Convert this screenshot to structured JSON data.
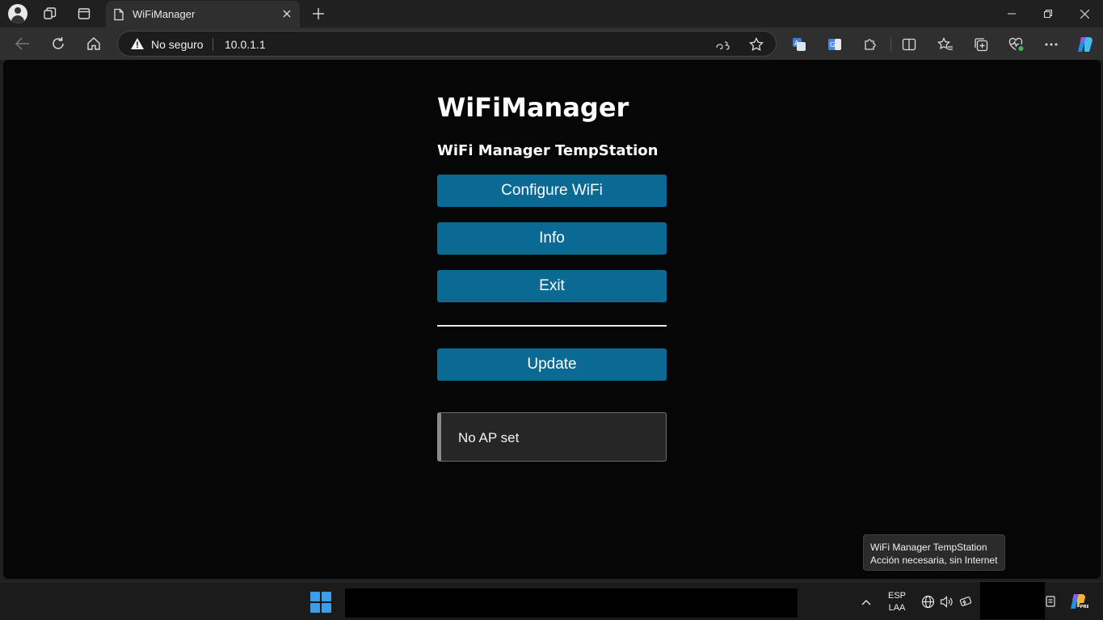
{
  "browser": {
    "tab": {
      "title": "WiFiManager"
    },
    "address": {
      "security_label": "No seguro",
      "url": "10.0.1.1"
    }
  },
  "page": {
    "title": "WiFiManager",
    "subtitle": "WiFi Manager TempStation",
    "buttons": {
      "configure": "Configure WiFi",
      "info": "Info",
      "exit": "Exit",
      "update": "Update"
    },
    "status_message": "No AP set"
  },
  "tooltip": {
    "line1": "WiFi Manager TempStation",
    "line2": "Acción necesaria, sin Internet"
  },
  "taskbar": {
    "language": {
      "lang": "ESP",
      "layout": "LAA"
    }
  },
  "colors": {
    "button": "#0b6a93",
    "page_background": "#060606",
    "browser_chrome": "#202020"
  }
}
